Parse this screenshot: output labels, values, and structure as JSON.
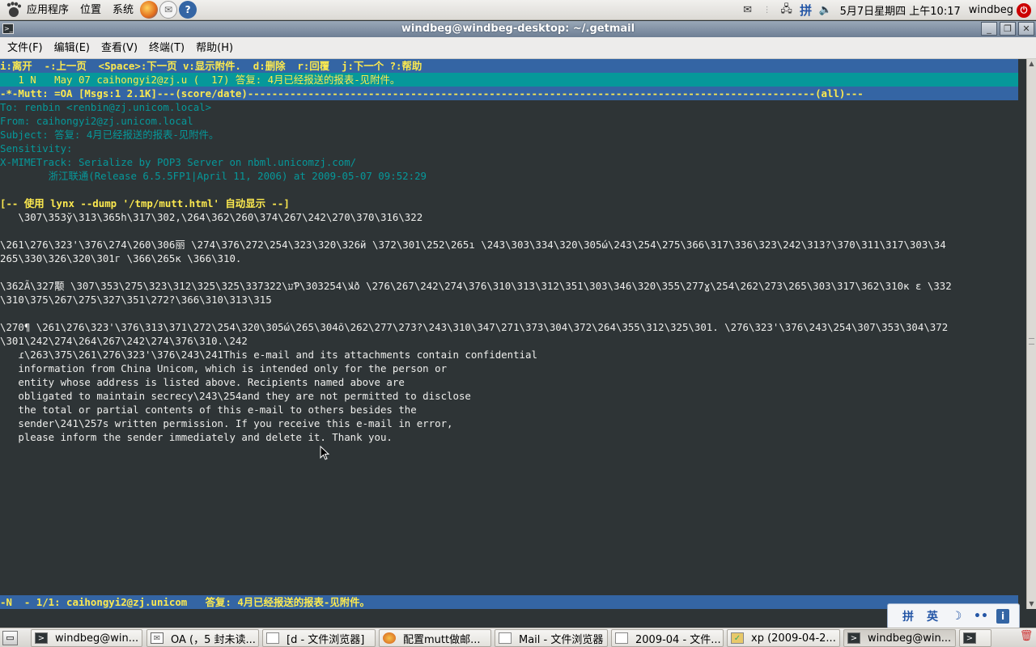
{
  "top_panel": {
    "menus": [
      "应用程序",
      "位置",
      "系统"
    ],
    "datetime": "5月7日星期四 上午10:17",
    "username": "windbeg",
    "ime_indicator": "拼"
  },
  "window": {
    "title": "windbeg@windbeg-desktop: ~/.getmail",
    "menu": [
      "文件(F)",
      "编辑(E)",
      "查看(V)",
      "终端(T)",
      "帮助(H)"
    ]
  },
  "mutt": {
    "help_line": "i:离开  -:上一页  <Space>:下一页 v:显示附件.  d:删除  r:回覆  j:下一个 ?:帮助",
    "index_line": "   1 N   May 07 caihongyi2@zj.u (  17) 答复: 4月已经报送的报表-见附件。",
    "status_line": "-*-Mutt: =OA [Msgs:1 2.1K]---(score/date)----------------------------------------------------------------------------------------------(all)---",
    "headers": [
      "To: renbin <renbin@zj.unicom.local>",
      "From: caihongyi2@zj.unicom.local",
      "Subject: 答复: 4月已经报送的报表-见附件。",
      "Sensitivity:",
      "X-MIMETrack: Serialize by POP3 Server on nbml.unicomzj.com/",
      "        浙江联通(Release 6.5.5FP1|April 11, 2006) at 2009-05-07 09:52:29"
    ],
    "attachment_notice": "[-- 使用 lynx --dump '/tmp/mutt.html' 自动显示 --]",
    "body": [
      "   \\307\\353ў\\313\\365h\\317\\302,\\264\\362\\260\\374\\267\\242\\270\\370\\316\\322",
      "",
      "\\261\\276\\323'\\376\\274\\260\\306丽 \\274\\376\\272\\254\\323\\320\\326й \\372\\301\\252\\265ı \\243\\303\\334\\320\\305ώ\\243\\254\\275\\366\\317\\336\\323\\242\\313?\\370\\311\\317\\303\\34",
      "265\\330\\326\\320\\301г \\366\\265ĸ \\366\\310.",
      "",
      "\\362Ã\\327颙 \\307\\353\\275\\323\\312\\325\\325\\337ע\\322Ƥ\\303ﻼ\\254ð \\276\\267\\242\\274\\376\\310\\313\\312\\351\\303\\346\\320\\355\\277ɣ\\254\\262\\273\\265\\303\\317\\362\\310ĸ ε \\332",
      "\\310\\375\\267\\275\\327\\351\\272?\\366\\310\\313\\315",
      "",
      "\\270¶ \\261\\276\\323'\\376\\313\\371\\272\\254\\320\\305ώ\\265\\304õ\\262\\277\\273?\\243\\310\\347\\271\\373\\304\\372\\264\\355\\312\\325\\301. \\276\\323'\\376\\243\\254\\307\\353\\304\\372",
      "\\301\\242\\274\\264\\267\\242\\274\\376\\310.\\242",
      "   ɾ\\263\\375\\261\\276\\323'\\376\\243\\241This e-mail and its attachments contain confidential",
      "   information from China Unicom, which is intended only for the person or",
      "   entity whose address is listed above. Recipients named above are",
      "   obligated to maintain secrecy\\243\\254and they are not permitted to disclose",
      "   the total or partial contents of this e-mail to others besides the",
      "   sender\\241\\257s written permission. If you receive this e-mail in error,",
      "   please inform the sender immediately and delete it. Thank you."
    ],
    "pager_status": "-N  - 1/1: caihongyi2@zj.unicom   答复: 4月已经报送的报表-见附件。"
  },
  "ime_bar": [
    "拼",
    "英",
    "☽",
    "••",
    "i"
  ],
  "taskbar": [
    "windbeg@win...",
    "OA (，5 封未读...",
    "[d - 文件浏览器]",
    "配置mutt做邮...",
    "Mail - 文件浏览器",
    "2009-04 - 文件...",
    "xp (2009-04-2...",
    "windbeg@win..."
  ],
  "colors": {
    "terminal_bg": "#2e3436",
    "status_bar": "#3465a4",
    "highlight": "#06989a",
    "header_text": "#06989a",
    "bar_text": "#fce94f"
  }
}
